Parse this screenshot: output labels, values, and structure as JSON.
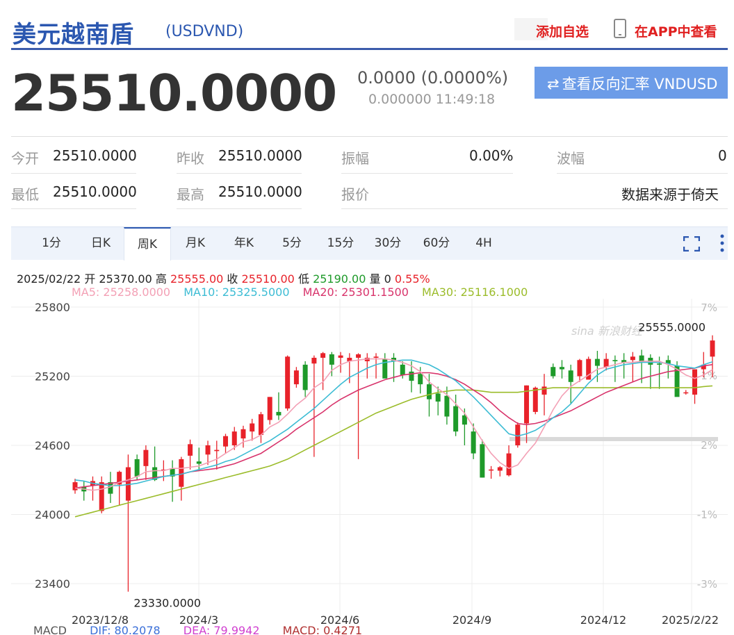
{
  "header": {
    "title": "美元越南盾",
    "code": "(USDVND)",
    "add_watch": "添加自选",
    "app_view": "在APP中查看"
  },
  "quote": {
    "price": "25510.0000",
    "change": "0.0000 (0.0000%)",
    "change_sub": "0.000000 11:49:18",
    "reverse_label": "查看反向汇率 VNDUSD"
  },
  "stats": {
    "open_label": "今开",
    "open": "25510.0000",
    "prev_label": "昨收",
    "prev": "25510.0000",
    "amp_label": "振幅",
    "amp": "0.00%",
    "wave_label": "波幅",
    "wave": "0",
    "low_label": "最低",
    "low": "25510.0000",
    "high_label": "最高",
    "high": "25510.0000",
    "quote_label": "报价",
    "source": "数据来源于倚天"
  },
  "tabs": [
    "1分",
    "日K",
    "周K",
    "月K",
    "年K",
    "5分",
    "15分",
    "30分",
    "60分",
    "4H"
  ],
  "active_tab": "周K",
  "ohlc": {
    "date": "2025/02/22",
    "open_label": "开",
    "open": "25370.00",
    "high_label": "高",
    "high": "25555.00",
    "close_label": "收",
    "close": "25510.00",
    "low_label": "低",
    "low": "25190.00",
    "vol_label": "量",
    "vol": "0",
    "pct": "0.55%"
  },
  "ma": {
    "ma5": "MA5: 25258.0000",
    "ma10": "MA10: 25325.5000",
    "ma20": "MA20: 25301.1500",
    "ma30": "MA30: 25116.1000"
  },
  "macd": {
    "label": "MACD",
    "dif": "DIF: 80.2078",
    "dea": "DEA: 79.9942",
    "macd": "MACD: 0.4271"
  },
  "colors": {
    "up": "#e8222a",
    "down": "#1e9a2a",
    "ma5": "#f3a0b5",
    "ma10": "#3cbcd4",
    "ma20": "#d8336b",
    "ma30": "#9bbc2a",
    "accent": "#2b57b0"
  },
  "chart_data": {
    "type": "candlestick",
    "y_ticks": [
      25800,
      25200,
      24600,
      24000,
      23400
    ],
    "pct_ticks": [
      "7%",
      "1%",
      "2%",
      "-1%",
      "-3%"
    ],
    "ylim": [
      23280,
      25850
    ],
    "x_labels": [
      "2023/12/8",
      "2024/3",
      "2024/6",
      "2024/9",
      "2024/12",
      "2025/2/22"
    ],
    "max_label": "25555.0000",
    "min_label": "23330.0000",
    "candles": [
      [
        24210,
        24310,
        24180,
        24280
      ],
      [
        24240,
        24290,
        24120,
        24200
      ],
      [
        24250,
        24330,
        24120,
        24290
      ],
      [
        24030,
        24330,
        24010,
        24280
      ],
      [
        24280,
        24370,
        24100,
        24180
      ],
      [
        24260,
        24380,
        24080,
        24370
      ],
      [
        24120,
        24520,
        23330,
        24410
      ],
      [
        24480,
        24520,
        24300,
        24330
      ],
      [
        24420,
        24600,
        24300,
        24560
      ],
      [
        24410,
        24590,
        24290,
        24300
      ],
      [
        24390,
        24470,
        24290,
        24390
      ],
      [
        24400,
        24470,
        24110,
        24330
      ],
      [
        24240,
        24500,
        24120,
        24480
      ],
      [
        24510,
        24650,
        24390,
        24610
      ],
      [
        24460,
        24580,
        24380,
        24440
      ],
      [
        24520,
        24640,
        24430,
        24600
      ],
      [
        24550,
        24640,
        24390,
        24560
      ],
      [
        24590,
        24700,
        24530,
        24680
      ],
      [
        24600,
        24760,
        24560,
        24720
      ],
      [
        24660,
        24770,
        24580,
        24740
      ],
      [
        24720,
        24830,
        24640,
        24790
      ],
      [
        24690,
        24890,
        24620,
        24870
      ],
      [
        24820,
        25020,
        24780,
        25020
      ],
      [
        24890,
        25060,
        24820,
        24860
      ],
      [
        24920,
        25380,
        24900,
        25370
      ],
      [
        25130,
        25280,
        25100,
        25250
      ],
      [
        25300,
        25330,
        25020,
        25080
      ],
      [
        25310,
        25380,
        24500,
        25360
      ],
      [
        25360,
        25410,
        25080,
        25400
      ],
      [
        25390,
        25410,
        25200,
        25300
      ],
      [
        25360,
        25410,
        25230,
        25380
      ],
      [
        25330,
        25400,
        25140,
        25360
      ],
      [
        25360,
        25400,
        24480,
        25390
      ],
      [
        25330,
        25400,
        25180,
        25360
      ],
      [
        25360,
        25400,
        25180,
        25370
      ],
      [
        25350,
        25400,
        25200,
        25180
      ],
      [
        25360,
        25400,
        25150,
        25330
      ],
      [
        25300,
        25330,
        25180,
        25210
      ],
      [
        25240,
        25330,
        25060,
        25160
      ],
      [
        25220,
        25280,
        25050,
        25130
      ],
      [
        25130,
        25220,
        24850,
        25000
      ],
      [
        25050,
        25110,
        24860,
        24980
      ],
      [
        25030,
        25110,
        24780,
        24850
      ],
      [
        24940,
        25040,
        24680,
        24720
      ],
      [
        24860,
        24920,
        24600,
        24780
      ],
      [
        24720,
        24790,
        24480,
        24530
      ],
      [
        24610,
        24650,
        24320,
        24320
      ],
      [
        24390,
        24420,
        24310,
        24390
      ],
      [
        24380,
        24420,
        24330,
        24410
      ],
      [
        24340,
        24600,
        24330,
        24530
      ],
      [
        24600,
        24800,
        24580,
        24780
      ],
      [
        24790,
        25120,
        24620,
        25120
      ],
      [
        24890,
        25110,
        24870,
        25100
      ],
      [
        25040,
        25220,
        24860,
        25110
      ],
      [
        25280,
        25310,
        25180,
        25200
      ],
      [
        25280,
        25340,
        25180,
        25260
      ],
      [
        25250,
        25300,
        24960,
        25150
      ],
      [
        25200,
        25350,
        25150,
        25340
      ],
      [
        25170,
        25370,
        25180,
        25350
      ],
      [
        25350,
        25420,
        25150,
        25290
      ],
      [
        25280,
        25400,
        25250,
        25350
      ],
      [
        25340,
        25380,
        25150,
        25330
      ],
      [
        25340,
        25400,
        25180,
        25320
      ],
      [
        25340,
        25410,
        25150,
        25370
      ],
      [
        25380,
        25430,
        25140,
        25320
      ],
      [
        25360,
        25390,
        25090,
        25300
      ],
      [
        25310,
        25370,
        25090,
        25300
      ],
      [
        25340,
        25380,
        25180,
        25310
      ],
      [
        25290,
        25330,
        25040,
        25020
      ],
      [
        25060,
        25080,
        25040,
        25060
      ],
      [
        25040,
        25260,
        24960,
        25260
      ],
      [
        25260,
        25410,
        25190,
        25300
      ],
      [
        25370,
        25555,
        25190,
        25510
      ]
    ],
    "ma5": [
      24230,
      24220,
      24210,
      24220,
      24240,
      24280,
      24300,
      24330,
      24370,
      24380,
      24380,
      24400,
      24400,
      24410,
      24420,
      24450,
      24480,
      24530,
      24580,
      24630,
      24650,
      24690,
      24760,
      24800,
      24870,
      24950,
      25010,
      25100,
      25150,
      25250,
      25300,
      25330,
      25340,
      25350,
      25350,
      25350,
      25340,
      25320,
      25290,
      25240,
      25150,
      25090,
      25040,
      24960,
      24880,
      24760,
      24640,
      24530,
      24450,
      24400,
      24430,
      24530,
      24620,
      24760,
      24910,
      25030,
      25110,
      25160,
      25210,
      25260,
      25280,
      25300,
      25320,
      25320,
      25330,
      25330,
      25330,
      25300,
      25260,
      25210,
      25180,
      25210,
      25258
    ],
    "ma10": [
      24300,
      24290,
      24270,
      24260,
      24250,
      24250,
      24260,
      24270,
      24290,
      24310,
      24330,
      24340,
      24350,
      24370,
      24390,
      24410,
      24430,
      24460,
      24480,
      24520,
      24560,
      24600,
      24640,
      24690,
      24740,
      24800,
      24860,
      24920,
      24990,
      25060,
      25130,
      25190,
      25230,
      25270,
      25300,
      25320,
      25330,
      25340,
      25340,
      25320,
      25300,
      25260,
      25210,
      25160,
      25090,
      25020,
      24940,
      24860,
      24780,
      24700,
      24680,
      24700,
      24730,
      24780,
      24840,
      24890,
      24960,
      25050,
      25140,
      25210,
      25260,
      25280,
      25300,
      25310,
      25320,
      25320,
      25320,
      25310,
      25290,
      25280,
      25270,
      25300,
      25325
    ],
    "ma20": [
      24230,
      24240,
      24250,
      24260,
      24270,
      24280,
      24290,
      24300,
      24310,
      24320,
      24330,
      24340,
      24350,
      24370,
      24380,
      24390,
      24400,
      24420,
      24440,
      24470,
      24500,
      24530,
      24580,
      24630,
      24680,
      24740,
      24790,
      24840,
      24890,
      24950,
      25000,
      25040,
      25080,
      25110,
      25140,
      25170,
      25190,
      25210,
      25220,
      25230,
      25230,
      25220,
      25200,
      25170,
      25130,
      25080,
      25030,
      24970,
      24900,
      24840,
      24790,
      24780,
      24790,
      24810,
      24840,
      24870,
      24900,
      24940,
      24980,
      25020,
      25060,
      25090,
      25120,
      25150,
      25180,
      25200,
      25220,
      25240,
      25250,
      25260,
      25270,
      25290,
      25301
    ],
    "ma30": [
      23980,
      24000,
      24020,
      24040,
      24060,
      24080,
      24100,
      24120,
      24140,
      24160,
      24180,
      24200,
      24220,
      24240,
      24260,
      24280,
      24300,
      24320,
      24340,
      24360,
      24380,
      24400,
      24420,
      24450,
      24480,
      24520,
      24560,
      24600,
      24640,
      24680,
      24720,
      24760,
      24800,
      24840,
      24880,
      24910,
      24940,
      24970,
      25000,
      25020,
      25040,
      25060,
      25070,
      25080,
      25080,
      25080,
      25070,
      25060,
      25060,
      25060,
      25060,
      25070,
      25080,
      25090,
      25100,
      25100,
      25100,
      25100,
      25100,
      25100,
      25100,
      25100,
      25100,
      25100,
      25100,
      25100,
      25100,
      25100,
      25100,
      25100,
      25100,
      25110,
      25116
    ]
  }
}
